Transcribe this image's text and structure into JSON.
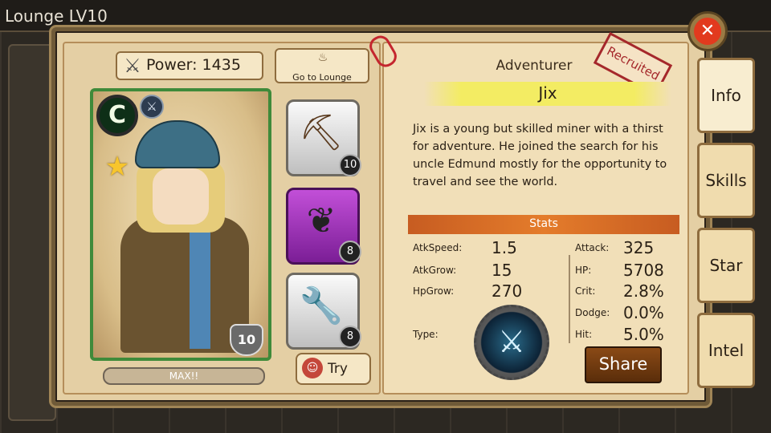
{
  "background": {
    "lounge_label": "Lounge LV10"
  },
  "power": {
    "icon": "crossed-swords-icon",
    "label": "Power: 1435"
  },
  "lounge_button": {
    "icon": "cauldron-icon",
    "label": "Go to Lounge"
  },
  "hero": {
    "class_badge": "C",
    "skill_badge_icon": "sword-icon",
    "stars": 1,
    "star_glyph": "★",
    "level": "10",
    "level_bar_label": "MAX!!"
  },
  "equipment": [
    {
      "name_icon": "pickaxe-icon",
      "glyph": "⛏",
      "level": "10",
      "rarity_color": "#bfbfbf"
    },
    {
      "name_icon": "amulet-icon",
      "glyph": "❦",
      "level": "8",
      "rarity_color": "#9b2bbd"
    },
    {
      "name_icon": "wrench-icon",
      "glyph": "🔧",
      "level": "8",
      "rarity_color": "#bfbfbf"
    }
  ],
  "try_button": {
    "label": "Try"
  },
  "info": {
    "class_label": "Adventurer",
    "recruited_stamp": "Recruited",
    "name": "Jix",
    "description": "Jix is a young but skilled miner with a thirst for adventure. He joined the search for his uncle Edmund mostly for the opportunity to travel and see the world."
  },
  "stats": {
    "title": "Stats",
    "left": [
      {
        "label": "AtkSpeed:",
        "value": "1.5"
      },
      {
        "label": "AtkGrow:",
        "value": "15"
      },
      {
        "label": "HpGrow:",
        "value": "270"
      }
    ],
    "type_label": "Type:",
    "right": [
      {
        "label": "Attack:",
        "value": "325"
      },
      {
        "label": "HP:",
        "value": "5708"
      },
      {
        "label": "Crit:",
        "value": "2.8%"
      },
      {
        "label": "Dodge:",
        "value": "0.0%"
      },
      {
        "label": "Hit:",
        "value": "5.0%"
      }
    ]
  },
  "share_button": {
    "label": "Share"
  },
  "tabs": [
    {
      "label": "Info",
      "active": true
    },
    {
      "label": "Skills",
      "active": false
    },
    {
      "label": "Star",
      "active": false
    },
    {
      "label": "Intel",
      "active": false
    }
  ],
  "close_button": {
    "glyph": "✕"
  }
}
